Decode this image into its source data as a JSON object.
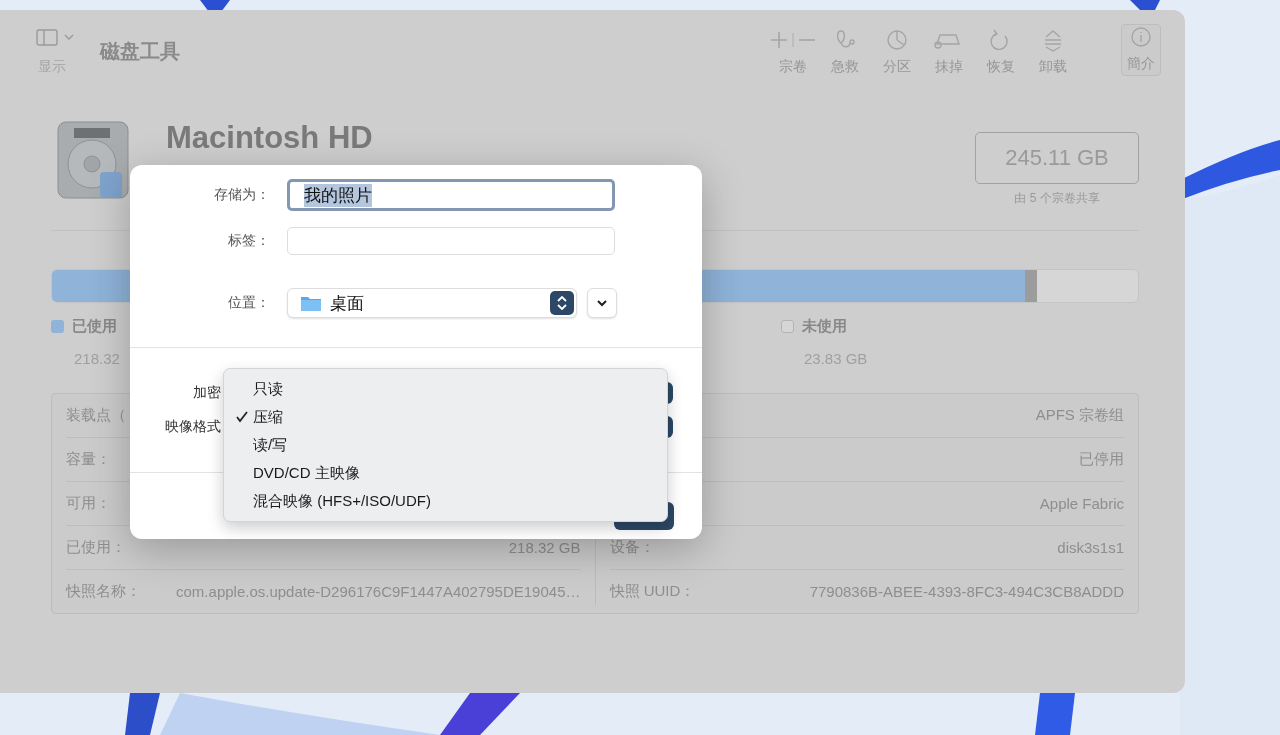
{
  "window": {
    "title": "磁盘工具"
  },
  "toolbar": {
    "sidebar_label": "显示",
    "items": [
      {
        "label": "宗卷",
        "kind": "volume"
      },
      {
        "label": "急救",
        "kind": "firstaid"
      },
      {
        "label": "分区",
        "kind": "partition"
      },
      {
        "label": "抹掉",
        "kind": "erase"
      },
      {
        "label": "恢复",
        "kind": "restore"
      },
      {
        "label": "卸载",
        "kind": "unmount"
      },
      {
        "label": "簡介",
        "kind": "info"
      }
    ]
  },
  "disk": {
    "name": "Macintosh HD",
    "capacity": "245.11 GB",
    "shared": "由 5 个宗卷共享"
  },
  "usage": {
    "segments": [
      {
        "level": 0.896,
        "color": "#8fb3d9"
      }
    ],
    "legend": [
      {
        "label": "已使用",
        "value": "218.32",
        "kind": "used",
        "color": "#8fb3d9"
      },
      {
        "label": "未使用",
        "value": "23.83 GB",
        "kind": "free",
        "color": "#d6d6d6"
      }
    ]
  },
  "info": {
    "left": [
      {
        "label": "装载点（"
      },
      {
        "label": "容量："
      },
      {
        "label": "可用："
      },
      {
        "label": "已使用：",
        "value": "218.32 GB"
      },
      {
        "label": "快照名称：",
        "value": "com.apple.os.update-D296176C9F1447A402795DE19045…"
      }
    ],
    "right": [
      {
        "value": "APFS 宗卷组"
      },
      {
        "value": "已停用"
      },
      {
        "value": "Apple Fabric"
      },
      {
        "label": "设备：",
        "value": "disk3s1s1"
      },
      {
        "label": "快照 UUID：",
        "value": "7790836B-ABEE-4393-8FC3-494C3CB8ADDD"
      }
    ]
  },
  "dialog": {
    "fields": [
      {
        "label": "存储为：",
        "value": "我的照片",
        "focused": true,
        "text_selected": true
      },
      {
        "label": "标签：",
        "focused": false
      }
    ],
    "location": {
      "label": "位置：",
      "value": "桌面"
    },
    "options": [
      {
        "label": "加密"
      },
      {
        "label": "映像格式"
      }
    ],
    "menu": [
      {
        "label": "只读",
        "selected": false
      },
      {
        "label": "压缩",
        "selected": true
      },
      {
        "label": "读/写",
        "selected": false
      },
      {
        "label": "DVD/CD 主映像",
        "selected": false
      },
      {
        "label": "混合映像 (HFS+/ISO/UDF)",
        "selected": false
      }
    ]
  }
}
